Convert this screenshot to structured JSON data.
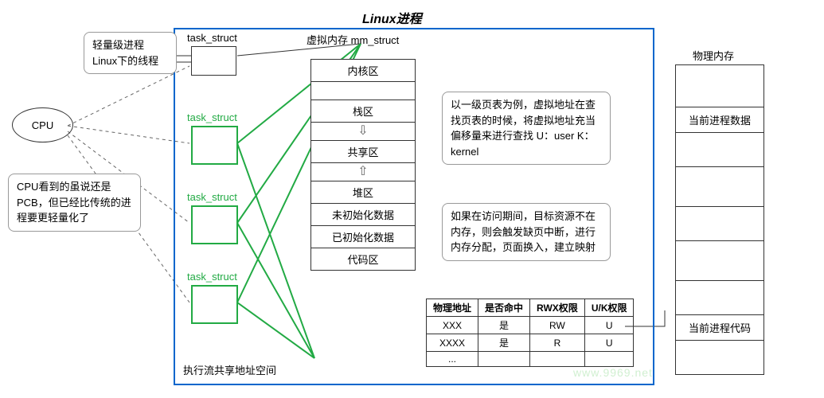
{
  "title": "Linux进程",
  "cpu": "CPU",
  "bubble_lwp": "轻量级进程\nLinux下的线程",
  "bubble_cpu": "CPU看到的虽说还是PCB，但已经比传统的进程要更轻量化了",
  "bubble_pte": "以一级页表为例，虚拟地址在查找页表的时候，将虚拟地址充当偏移量来进行查找\n\nU：user  K：kernel",
  "bubble_fault": "如果在访问期间，目标资源不在内存，则会触发缺页中断，进行内存分配，页面换入，建立映射",
  "labels": {
    "task_struct": "task_struct",
    "mm_struct": "虚拟内存 mm_struct",
    "exec_shared": "执行流共享地址空间",
    "phys_mem": "物理内存"
  },
  "mm_regions": [
    "内核区",
    "栈区",
    "共享区",
    "堆区",
    "未初始化数据",
    "已初始化数据",
    "代码区"
  ],
  "page_table": {
    "headers": [
      "物理地址",
      "是否命中",
      "RWX权限",
      "U/K权限"
    ],
    "rows": [
      [
        "XXX",
        "是",
        "RW",
        "U"
      ],
      [
        "XXXX",
        "是",
        "R",
        "U"
      ],
      [
        "...",
        "",
        "",
        ""
      ]
    ]
  },
  "phys": {
    "data": "当前进程数据",
    "code": "当前进程代码"
  },
  "watermark": "www.9969.net"
}
